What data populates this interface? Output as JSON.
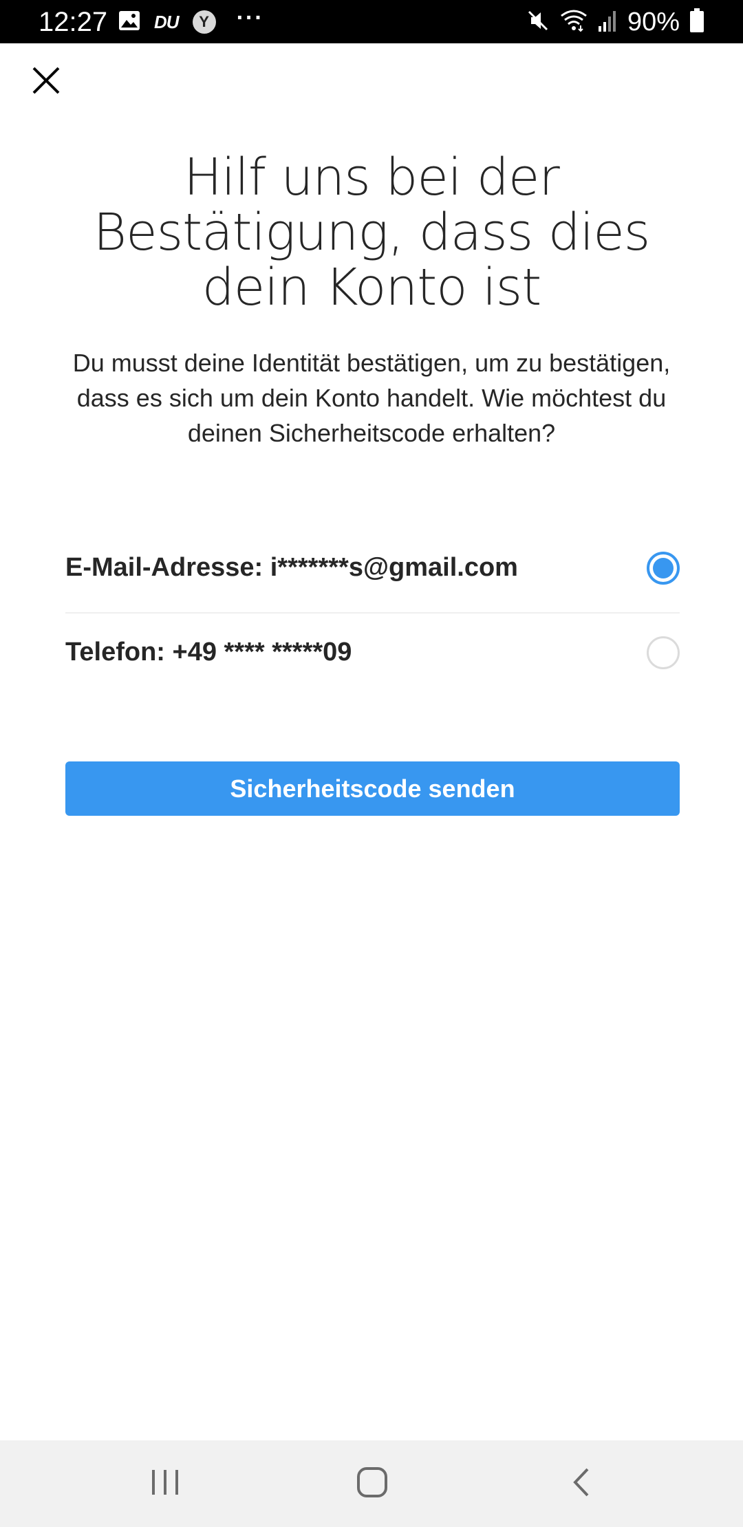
{
  "status_bar": {
    "time": "12:27",
    "left_icons": [
      "image-icon",
      "du-icon",
      "y-icon",
      "more-dots-icon"
    ],
    "du_label": "DU",
    "y_label": "Y",
    "right_icons": [
      "mute-icon",
      "wifi-icon",
      "signal-icon",
      "battery-icon"
    ],
    "battery_percent": "90%"
  },
  "header": {
    "close_icon": "close-icon"
  },
  "main": {
    "title": "Hilf uns bei der Bestätigung, dass dies dein Konto ist",
    "subtitle": "Du musst deine Identität bestätigen, um zu bestätigen, dass es sich um dein Konto handelt. Wie möchtest du deinen Sicherheitscode erhalten?",
    "options": [
      {
        "label": "E-Mail-Adresse: i*******s@gmail.com",
        "selected": true
      },
      {
        "label": "Telefon: +49 **** *****09",
        "selected": false
      }
    ],
    "send_button_label": "Sicherheitscode senden"
  },
  "nav_bar": {
    "buttons": [
      "recents-icon",
      "home-icon",
      "back-icon"
    ]
  },
  "colors": {
    "accent": "#3897f0",
    "text": "#262626",
    "status_bar_bg": "#000000",
    "nav_bar_bg": "#f1f1f1"
  }
}
